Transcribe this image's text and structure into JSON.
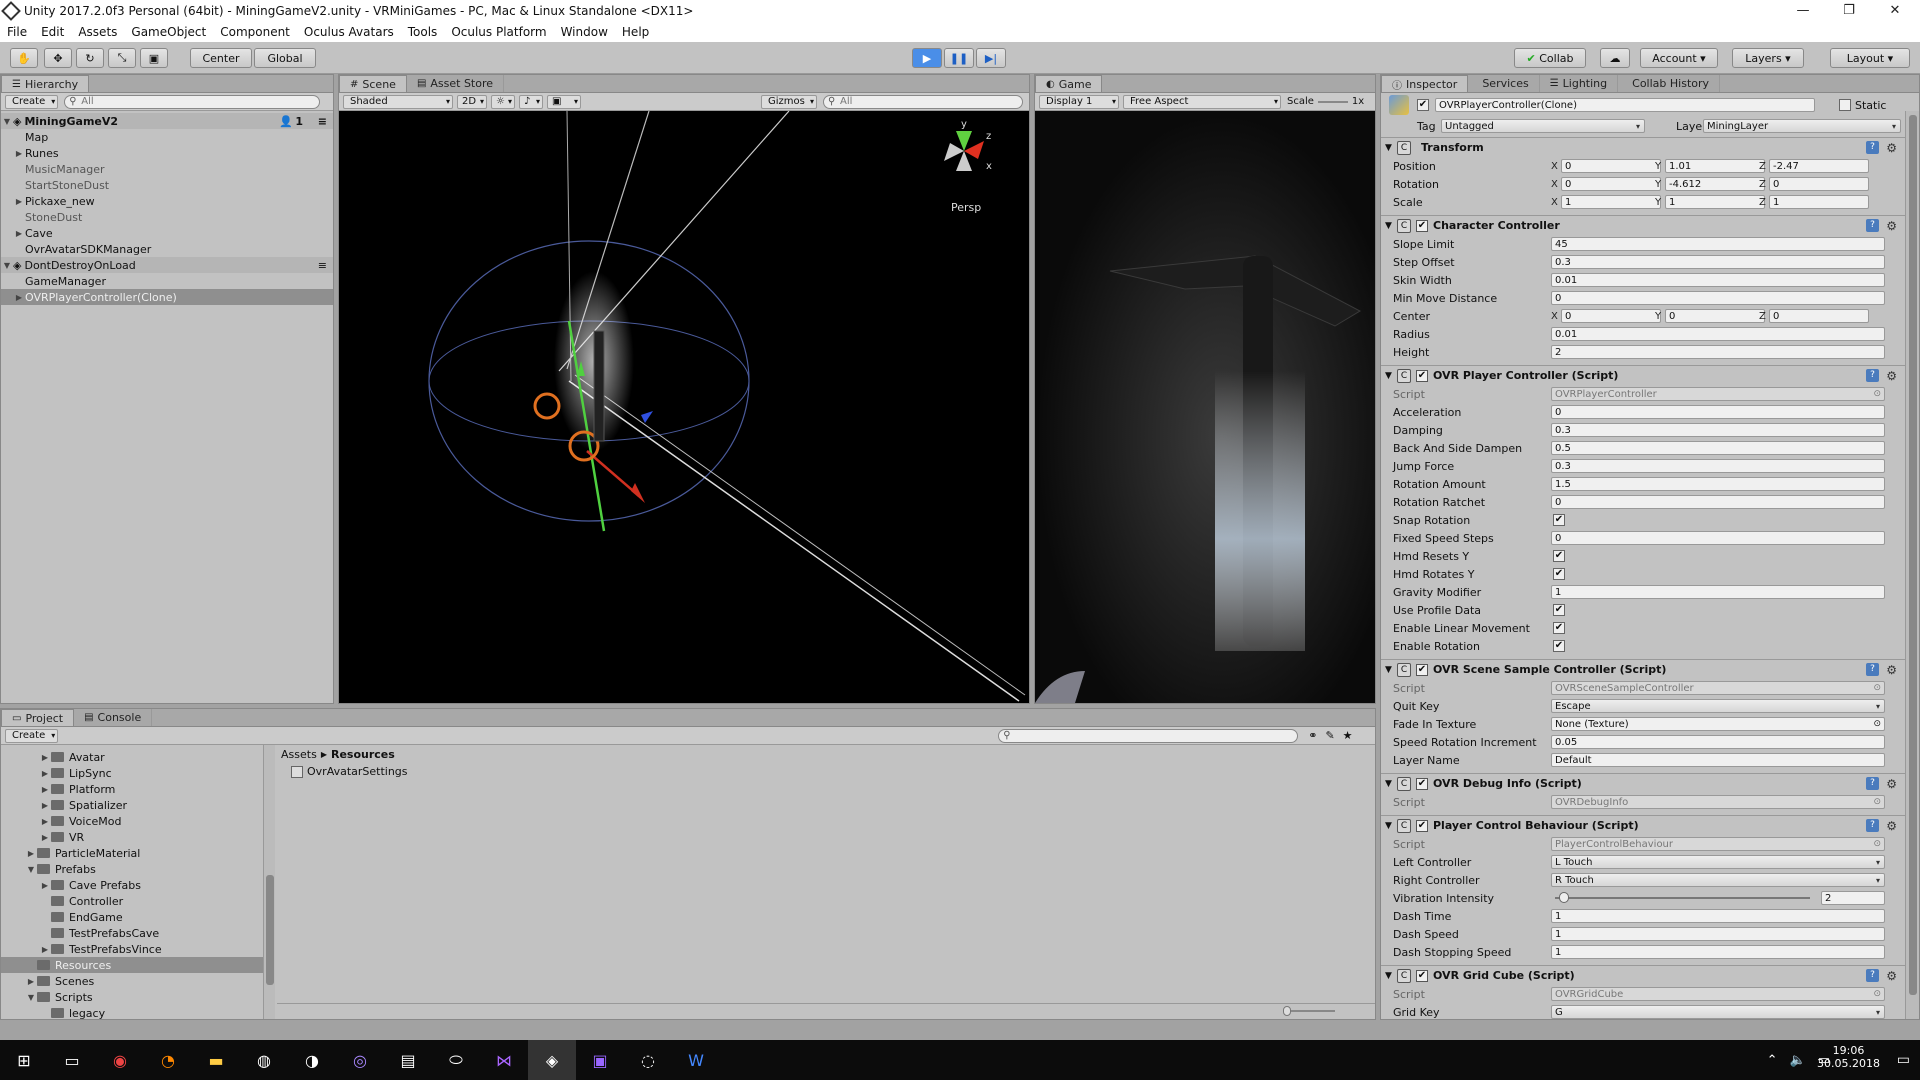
{
  "window": {
    "title": "Unity 2017.2.0f3 Personal (64bit) - MiningGameV2.unity - VRMiniGames - PC, Mac & Linux Standalone <DX11>"
  },
  "menu": [
    "File",
    "Edit",
    "Assets",
    "GameObject",
    "Component",
    "Oculus Avatars",
    "Tools",
    "Oculus Platform",
    "Window",
    "Help"
  ],
  "toolbar": {
    "center": "Center",
    "global": "Global",
    "collab": "Collab",
    "account": "Account",
    "layers": "Layers",
    "layout": "Layout"
  },
  "hierarchy": {
    "tab": "Hierarchy",
    "create": "Create",
    "search": "All",
    "scene": "MiningGameV2",
    "badge": "1",
    "rows": [
      {
        "label": "Map",
        "indent": 1,
        "arrow": "",
        "style": ""
      },
      {
        "label": "Runes",
        "indent": 1,
        "arrow": "▶",
        "style": ""
      },
      {
        "label": "MusicManager",
        "indent": 1,
        "arrow": "",
        "style": "grey"
      },
      {
        "label": "StartStoneDust",
        "indent": 1,
        "arrow": "",
        "style": "grey"
      },
      {
        "label": "Pickaxe_new",
        "indent": 1,
        "arrow": "▶",
        "style": ""
      },
      {
        "label": "StoneDust",
        "indent": 1,
        "arrow": "",
        "style": "grey"
      },
      {
        "label": "Cave",
        "indent": 1,
        "arrow": "▶",
        "style": ""
      },
      {
        "label": "OvrAvatarSDKManager",
        "indent": 1,
        "arrow": "",
        "style": ""
      },
      {
        "label": "DontDestroyOnLoad",
        "indent": 0,
        "arrow": "▼",
        "style": "sec"
      },
      {
        "label": "GameManager",
        "indent": 1,
        "arrow": "",
        "style": ""
      },
      {
        "label": "OVRPlayerController(Clone)",
        "indent": 1,
        "arrow": "▶",
        "style": "sel"
      }
    ]
  },
  "scene": {
    "tab": "Scene",
    "tab2": "Asset Store",
    "shaded": "Shaded",
    "mode2d": "2D",
    "gizmos": "Gizmos",
    "search": "All",
    "persp": "Persp"
  },
  "game": {
    "tab": "Game",
    "display": "Display 1",
    "aspect": "Free Aspect",
    "scale": "Scale",
    "scale_val": "1x"
  },
  "project": {
    "tab": "Project",
    "tab2": "Console",
    "create": "Create",
    "breadcrumb": [
      "Assets",
      "Resources"
    ],
    "asset": "OvrAvatarSettings",
    "tree": [
      {
        "label": "Avatar",
        "indent": 2,
        "arrow": "▶"
      },
      {
        "label": "LipSync",
        "indent": 2,
        "arrow": "▶"
      },
      {
        "label": "Platform",
        "indent": 2,
        "arrow": "▶"
      },
      {
        "label": "Spatializer",
        "indent": 2,
        "arrow": "▶"
      },
      {
        "label": "VoiceMod",
        "indent": 2,
        "arrow": "▶"
      },
      {
        "label": "VR",
        "indent": 2,
        "arrow": "▶"
      },
      {
        "label": "ParticleMaterial",
        "indent": 1,
        "arrow": "▶"
      },
      {
        "label": "Prefabs",
        "indent": 1,
        "arrow": "▼"
      },
      {
        "label": "Cave Prefabs",
        "indent": 2,
        "arrow": "▶"
      },
      {
        "label": "Controller",
        "indent": 2,
        "arrow": ""
      },
      {
        "label": "EndGame",
        "indent": 2,
        "arrow": ""
      },
      {
        "label": "TestPrefabsCave",
        "indent": 2,
        "arrow": ""
      },
      {
        "label": "TestPrefabsVince",
        "indent": 2,
        "arrow": "▶"
      },
      {
        "label": "Resources",
        "indent": 1,
        "arrow": "",
        "sel": true
      },
      {
        "label": "Scenes",
        "indent": 1,
        "arrow": "▶"
      },
      {
        "label": "Scripts",
        "indent": 1,
        "arrow": "▼"
      },
      {
        "label": "legacy",
        "indent": 2,
        "arrow": ""
      }
    ]
  },
  "inspector": {
    "tabs": [
      "Inspector",
      "Services",
      "Lighting",
      "Collab History"
    ],
    "object": "OVRPlayerController(Clone)",
    "static": "Static",
    "tag_label": "Tag",
    "tag": "Untagged",
    "layer_label": "Layer",
    "layer": "MiningLayer",
    "transform": {
      "name": "Transform",
      "position": {
        "label": "Position",
        "x": "0",
        "y": "1.01",
        "z": "-2.47"
      },
      "rotation": {
        "label": "Rotation",
        "x": "0",
        "y": "-4.612",
        "z": "0"
      },
      "scale": {
        "label": "Scale",
        "x": "1",
        "y": "1",
        "z": "1"
      }
    },
    "cc": {
      "name": "Character Controller",
      "rows": [
        [
          "Slope Limit",
          "45"
        ],
        [
          "Step Offset",
          "0.3"
        ],
        [
          "Skin Width",
          "0.01"
        ],
        [
          "Min Move Distance",
          "0"
        ]
      ],
      "center": {
        "label": "Center",
        "x": "0",
        "y": "0",
        "z": "0"
      },
      "rows2": [
        [
          "Radius",
          "0.01"
        ],
        [
          "Height",
          "2"
        ]
      ]
    },
    "opc": {
      "name": "OVR Player Controller (Script)",
      "script": "OVRPlayerController",
      "rows": [
        [
          "Acceleration",
          "0",
          "f"
        ],
        [
          "Damping",
          "0.3",
          "f"
        ],
        [
          "Back And Side Dampen",
          "0.5",
          "f"
        ],
        [
          "Jump Force",
          "0.3",
          "f"
        ],
        [
          "Rotation Amount",
          "1.5",
          "f"
        ],
        [
          "Rotation Ratchet",
          "0",
          "f"
        ],
        [
          "Snap Rotation",
          "✔",
          "c"
        ],
        [
          "Fixed Speed Steps",
          "0",
          "f"
        ],
        [
          "Hmd Resets Y",
          "✔",
          "c"
        ],
        [
          "Hmd Rotates Y",
          "✔",
          "c"
        ],
        [
          "Gravity Modifier",
          "1",
          "f"
        ],
        [
          "Use Profile Data",
          "✔",
          "c"
        ],
        [
          "Enable Linear Movement",
          "✔",
          "c"
        ],
        [
          "Enable Rotation",
          "✔",
          "c"
        ]
      ]
    },
    "ossc": {
      "name": "OVR Scene Sample Controller (Script)",
      "script": "OVRSceneSampleController",
      "rows": [
        [
          "Quit Key",
          "Escape",
          "e"
        ],
        [
          "Fade In Texture",
          "None (Texture)",
          "o"
        ],
        [
          "Speed Rotation Increment",
          "0.05",
          "f"
        ],
        [
          "Layer Name",
          "Default",
          "f"
        ]
      ]
    },
    "odi": {
      "name": "OVR Debug Info (Script)",
      "script": "OVRDebugInfo"
    },
    "pcb": {
      "name": "Player Control Behaviour (Script)",
      "script": "PlayerControlBehaviour",
      "rows": [
        [
          "Left Controller",
          "L Touch",
          "e"
        ],
        [
          "Right Controller",
          "R Touch",
          "e"
        ]
      ],
      "vib": {
        "label": "Vibration Intensity",
        "value": "2"
      },
      "rows2": [
        [
          "Dash Time",
          "1",
          "f"
        ],
        [
          "Dash Speed",
          "1",
          "f"
        ],
        [
          "Dash Stopping Speed",
          "1",
          "f"
        ]
      ]
    },
    "ogc": {
      "name": "OVR Grid Cube (Script)",
      "script": "OVRGridCube",
      "rows": [
        [
          "Grid Key",
          "G",
          "e"
        ]
      ]
    },
    "script_label": "Script"
  },
  "taskbar": {
    "time": "19:06",
    "date": "30.05.2018"
  }
}
